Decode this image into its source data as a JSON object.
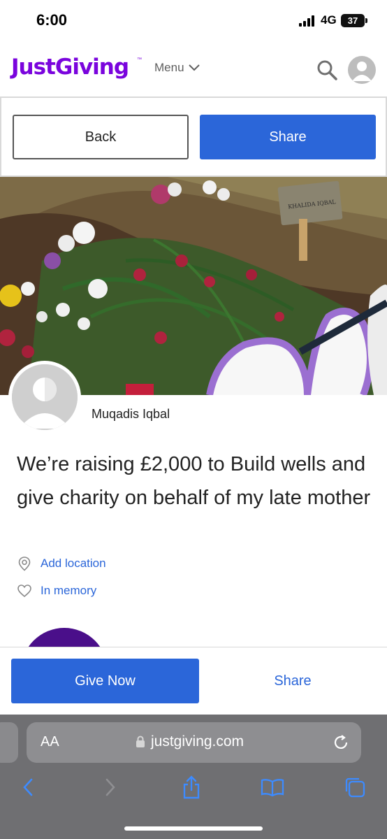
{
  "status_bar": {
    "time": "6:00",
    "network": "4G",
    "battery": "37"
  },
  "header": {
    "logo": "JustGiving",
    "logo_tm": "™",
    "menu_label": "Menu"
  },
  "action_bar": {
    "back_label": "Back",
    "share_label": "Share"
  },
  "fundraiser": {
    "owner_name": "Muqadis Iqbal",
    "title": "We’re raising £2,000 to Build wells and give charity on behalf of my late mother",
    "location_label": "Add location",
    "memory_label": "In memory"
  },
  "hero_image": {
    "plaque_name": "KHALIDA IQBAL"
  },
  "sticky": {
    "give_label": "Give Now",
    "share_label": "Share"
  },
  "browser": {
    "text_size_label": "AA",
    "url": "justgiving.com"
  },
  "colors": {
    "brand_purple": "#7a04dd",
    "primary_blue": "#2b66d9",
    "browser_gray": "#6f6f72"
  },
  "icons": [
    "search-icon",
    "user-icon",
    "chevron-down-icon",
    "location-pin-icon",
    "heart-icon",
    "lock-icon",
    "reload-icon",
    "back-arrow-icon",
    "forward-arrow-icon",
    "share-icon",
    "bookmarks-icon",
    "tabs-icon"
  ]
}
